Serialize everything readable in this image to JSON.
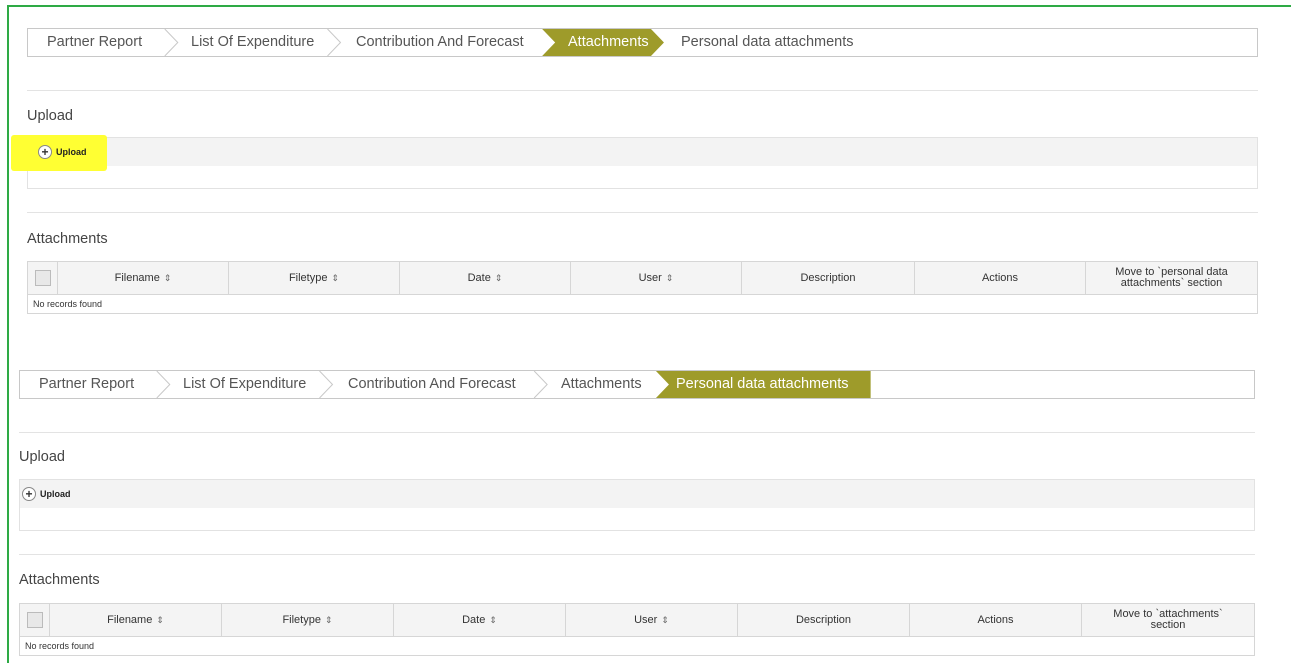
{
  "colors": {
    "accent": "#9e9b2a",
    "frame": "#2eaa45",
    "highlight": "#ffff33"
  },
  "panel1": {
    "breadcrumbs": [
      "Partner Report",
      "List Of Expenditure",
      "Contribution And Forecast",
      "Attachments",
      "Personal data attachments"
    ],
    "active_index": 3,
    "upload_title": "Upload",
    "upload_button": "Upload",
    "attachments_title": "Attachments",
    "columns": [
      "Filename",
      "Filetype",
      "Date",
      "User",
      "Description",
      "Actions",
      "Move to `personal data attachments` section"
    ],
    "sortable": [
      true,
      true,
      true,
      true,
      false,
      false,
      false
    ],
    "empty_text": "No records found"
  },
  "panel2": {
    "breadcrumbs": [
      "Partner Report",
      "List Of Expenditure",
      "Contribution And Forecast",
      "Attachments",
      "Personal data attachments"
    ],
    "active_index": 4,
    "upload_title": "Upload",
    "upload_button": "Upload",
    "attachments_title": "Attachments",
    "columns": [
      "Filename",
      "Filetype",
      "Date",
      "User",
      "Description",
      "Actions",
      "Move to `attachments` section"
    ],
    "sortable": [
      true,
      true,
      true,
      true,
      false,
      false,
      false
    ],
    "empty_text": "No records found"
  },
  "icons": {
    "upload": "plus-circle-icon",
    "sort": "sort-icon"
  }
}
